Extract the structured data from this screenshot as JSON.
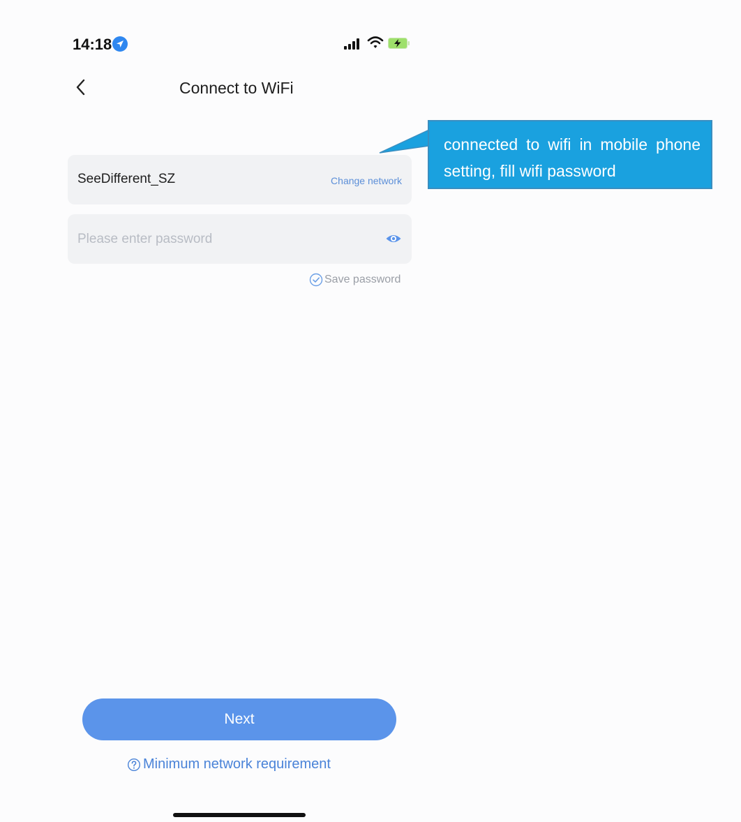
{
  "status_bar": {
    "time": "14:18",
    "icons": [
      "location-icon",
      "signal-icon",
      "wifi-icon",
      "battery-charging-icon"
    ]
  },
  "nav": {
    "back_icon": "chevron-left-icon",
    "title": "Connect to WiFi"
  },
  "network": {
    "ssid": "SeeDifferent_SZ",
    "change_label": "Change network"
  },
  "password": {
    "value": "",
    "placeholder": "Please enter password",
    "visibility_icon": "eye-icon",
    "save_label": "Save password",
    "save_checked": true
  },
  "callout": {
    "text": "connected to wifi in mobile phone setting, fill wifi password"
  },
  "footer": {
    "next_label": "Next",
    "requirement_label": "Minimum network requirement",
    "requirement_icon": "question-circle-icon"
  },
  "colors": {
    "accent": "#5b94ea",
    "link": "#5c8fd8",
    "field_bg": "#f1f2f4",
    "callout_bg": "#1aa1df",
    "location_badge": "#2f87f0"
  }
}
